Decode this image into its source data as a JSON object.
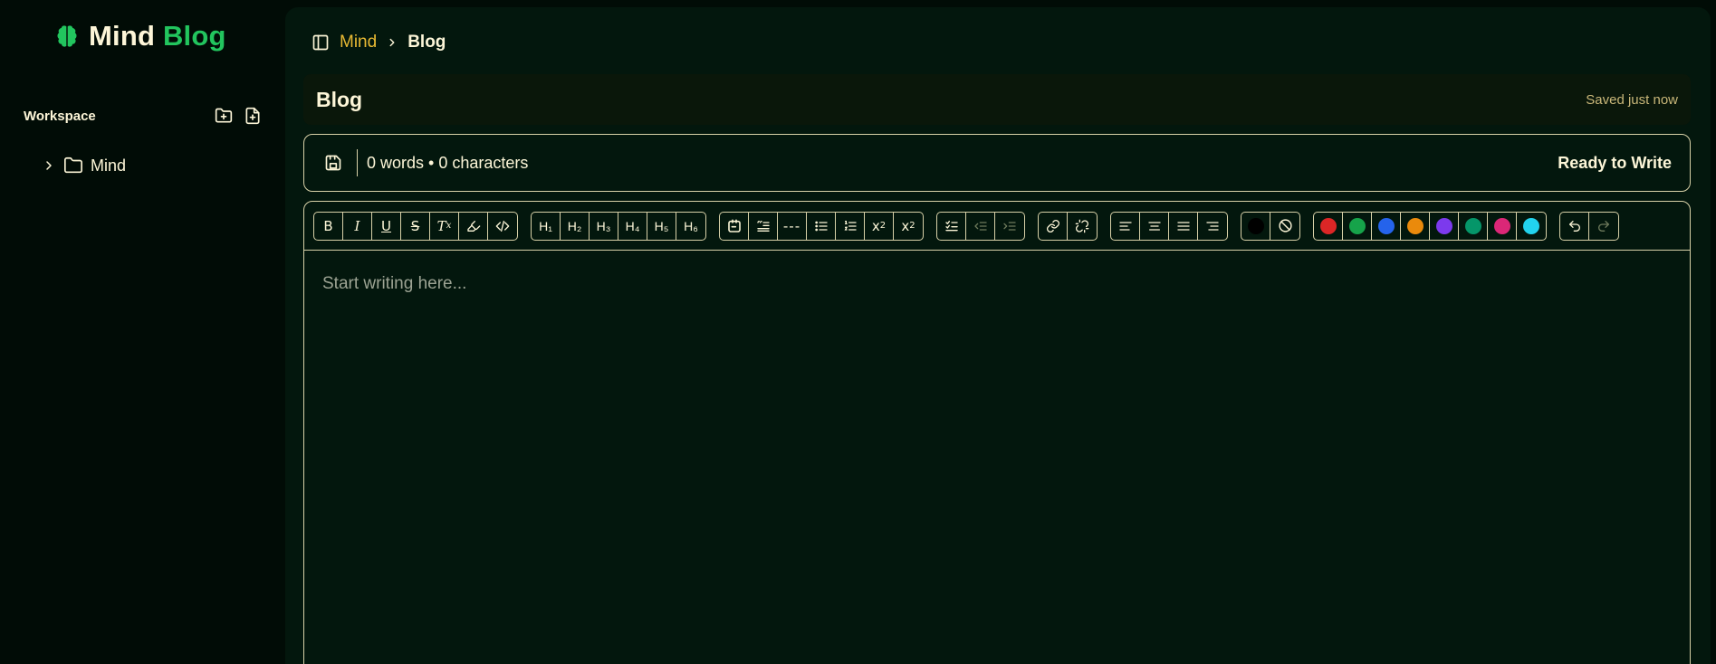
{
  "app": {
    "logo_word1": "Mind",
    "logo_word2": "Blog",
    "brand_green": "#22c55e",
    "accent_yellow": "#e8b933"
  },
  "sidebar": {
    "workspace_label": "Workspace",
    "new_folder_icon": "folder-plus-icon",
    "new_file_icon": "file-plus-icon",
    "tree": [
      {
        "label": "Mind",
        "icon": "folder-icon",
        "expanded": false
      }
    ]
  },
  "breadcrumb": {
    "items": [
      "Mind",
      "Blog"
    ]
  },
  "document": {
    "title": "Blog",
    "saved_status": "Saved just now"
  },
  "status_bar": {
    "counts": "0 words • 0 characters",
    "ready": "Ready to Write"
  },
  "toolbar": {
    "headings": [
      "H₁",
      "H₂",
      "H₃",
      "H₄",
      "H₅",
      "H₆"
    ],
    "text_colors": [
      "#000000"
    ],
    "palette": [
      "#dc2626",
      "#16a34a",
      "#2563eb",
      "#ea8a0c",
      "#7c3aed",
      "#059669",
      "#db2777",
      "#22d3ee"
    ]
  },
  "editor": {
    "placeholder": "Start writing here..."
  }
}
